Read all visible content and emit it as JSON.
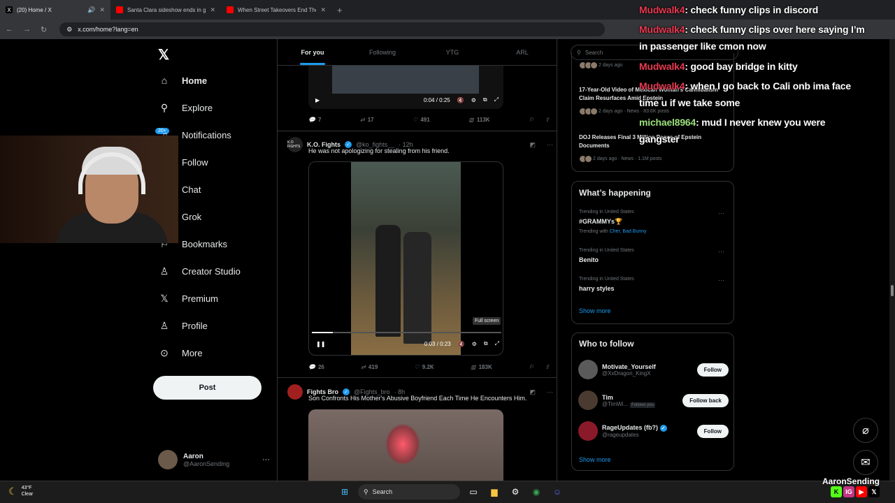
{
  "browser": {
    "tabs": [
      {
        "title": "(20) Home / X",
        "icon": "x-logo-icon",
        "active": true
      },
      {
        "title": "Santa Clara sideshow ends in g",
        "icon": "youtube-icon",
        "active": false
      },
      {
        "title": "When Street Takeovers End The",
        "icon": "youtube-icon",
        "active": false
      }
    ],
    "new_tab": "+",
    "url": "x.com/home?lang=en"
  },
  "x_logo": "𝕏",
  "nav": {
    "items": [
      {
        "label": "Home",
        "icon": "home-icon",
        "glyph": "⌂"
      },
      {
        "label": "Explore",
        "icon": "search-icon",
        "glyph": "⚲"
      },
      {
        "label": "Notifications",
        "icon": "bell-icon",
        "glyph": "🔔"
      },
      {
        "label": "Follow",
        "icon": "follow-icon",
        "glyph": "👤"
      },
      {
        "label": "Chat",
        "icon": "chat-icon",
        "glyph": "✉"
      },
      {
        "label": "Grok",
        "icon": "grok-icon",
        "glyph": "◩"
      },
      {
        "label": "Bookmarks",
        "icon": "bookmark-icon",
        "glyph": "⚐"
      },
      {
        "label": "Creator Studio",
        "icon": "creator-studio-icon",
        "glyph": "⚱"
      },
      {
        "label": "Premium",
        "icon": "premium-icon",
        "glyph": "𝕏"
      },
      {
        "label": "Profile",
        "icon": "profile-icon",
        "glyph": "⚇"
      },
      {
        "label": "More",
        "icon": "more-icon",
        "glyph": "⋯"
      }
    ],
    "notifications_badge": "20+",
    "post_label": "Post"
  },
  "account": {
    "name": "Aaron",
    "handle": "@AaronSending",
    "menu": "···"
  },
  "feed": {
    "tabs": [
      "For you",
      "Following",
      "YTG",
      "ARL"
    ],
    "post1": {
      "time": "0:04 / 0:25",
      "replies": "7",
      "reposts": "17",
      "likes": "491",
      "views": "113K"
    },
    "post2": {
      "name": "K.O. Fights",
      "handle": "@ko_fights__",
      "age": "· 12h",
      "text": "He was not apologizing for stealing from his friend.",
      "time": "0:03 / 0:23",
      "tooltip": "Full screen",
      "replies": "26",
      "reposts": "419",
      "likes": "9.2K",
      "views": "183K",
      "avatar_text": "K.O FIGHTS"
    },
    "post3": {
      "name": "Fights Bro",
      "handle": "@Fights_bro",
      "age": "· 8h",
      "text": "Son Confronts His Mother's Abusive Boyfriend Each Time He Encounters Him."
    }
  },
  "right": {
    "search_placeholder": "Search",
    "news": [
      {
        "title": "",
        "meta": "2 days ago"
      },
      {
        "title": "17-Year-Old Video of Mexican Woman's Cannibalism Claim Resurfaces Amid Epstein",
        "meta": "2 days ago · News · 83.6K posts"
      },
      {
        "title": "DOJ Releases Final 3 Million Pages of Epstein Documents",
        "meta": "2 days ago · News · 1.1M posts"
      }
    ],
    "happening_title": "What’s happening",
    "trends": [
      {
        "context": "Trending in United States",
        "name": "#GRAMMYs🏆",
        "with_label": "Trending with",
        "with": "Cher, Bad Bunny"
      },
      {
        "context": "Trending in United States",
        "name": "Benito"
      },
      {
        "context": "Trending in United States",
        "name": "harry styles"
      }
    ],
    "show_more": "Show more",
    "who_title": "Who to follow",
    "follow": [
      {
        "name": "Motivate_Yourself",
        "handle": "@XxDragon_KingX",
        "btn": "Follow"
      },
      {
        "name": "Tim",
        "handle": "@TimWi...",
        "tag": "Follows you",
        "btn": "Follow back"
      },
      {
        "name": "RageUpdates (fb?)",
        "handle": "@rageupdates",
        "btn": "Follow",
        "verified": true
      }
    ],
    "show_more2": "Show more"
  },
  "chat": [
    {
      "user": "Mudwalk4",
      "msg": ": check funny clips in discord"
    },
    {
      "user": "Mudwalk4",
      "msg": ": check funny clips over here saying I’m"
    },
    {
      "user": "",
      "msg": "in passenger like cmon now"
    },
    {
      "user": "Mudwalk4",
      "msg": ": good bay bridge in kitty"
    },
    {
      "user": "Mudwalk4",
      "msg": ": when I go back to Cali onb ima face"
    },
    {
      "user": "",
      "msg": "time u if we take some"
    },
    {
      "user": "michael8964",
      "msg": ": mud I never knew you were"
    },
    {
      "user": "",
      "msg": "gangster"
    }
  ],
  "taskbar": {
    "temp": "43°F",
    "weather": "Clear",
    "search": "Search"
  },
  "brand": {
    "name": "AaronSending",
    "icons": [
      "K",
      "IG",
      "▶",
      "𝕏"
    ],
    "colors": [
      "#53fc18",
      "#c13584",
      "#ff0000",
      "#000000"
    ]
  }
}
